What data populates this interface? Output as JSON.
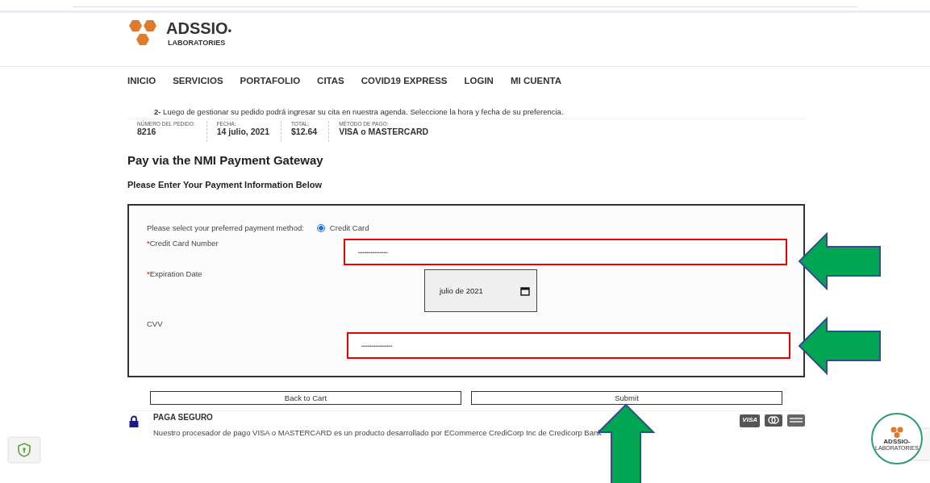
{
  "logo": {
    "name": "ADSSIO",
    "suffix": "•",
    "sub": "LABORATORIES"
  },
  "nav": [
    {
      "label": "INICIO"
    },
    {
      "label": "SERVICIOS"
    },
    {
      "label": "PORTAFOLIO"
    },
    {
      "label": "CITAS"
    },
    {
      "label": "COVID19 EXPRESS"
    },
    {
      "label": "LOGIN"
    },
    {
      "label": "MI CUENTA"
    }
  ],
  "instruction": {
    "number": "2-",
    "text": "Luego de gestionar su pedido podrá ingresar su cita en nuestra agenda. Seleccione la hora y fecha de su preferencia."
  },
  "order": [
    {
      "label": "NÚMERO DEL PEDIDO:",
      "value": "8216"
    },
    {
      "label": "FECHA:",
      "value": "14 julio, 2021"
    },
    {
      "label": "TOTAL:",
      "value": "$12.64"
    },
    {
      "label": "MÉTODO DE PAGO:",
      "value": "VISA o MASTERCARD"
    }
  ],
  "title": "Pay via the NMI Payment Gateway",
  "subtitle": "Please Enter Your Payment Information Below",
  "form": {
    "method_label": "Please select your preferred payment method:",
    "method_option": {
      "label": "Credit Card",
      "selected": true
    },
    "fields": [
      {
        "kind": "text",
        "mark": "*",
        "label": "Credit Card Number",
        "value": "•••••••••••••••••••••"
      },
      {
        "kind": "month",
        "mark": "*",
        "label": "Expiration Date",
        "value": "julio de 2021"
      },
      {
        "kind": "text",
        "label": "CVV",
        "value": "••••••••••••••••••••••"
      }
    ]
  },
  "buttons": [
    "Back to Cart",
    "Submit"
  ],
  "secure": {
    "title": "PAGA SEGURO",
    "text": "Nuestro procesador de pago VISA o MASTERCARD es un producto desarrollado por ECommerce CrediCorp Inc de Credicorp Bank",
    "cards": [
      "VISA"
    ]
  },
  "badge": {
    "name": "ADSSIO-",
    "sub": "LABORATORIES"
  }
}
